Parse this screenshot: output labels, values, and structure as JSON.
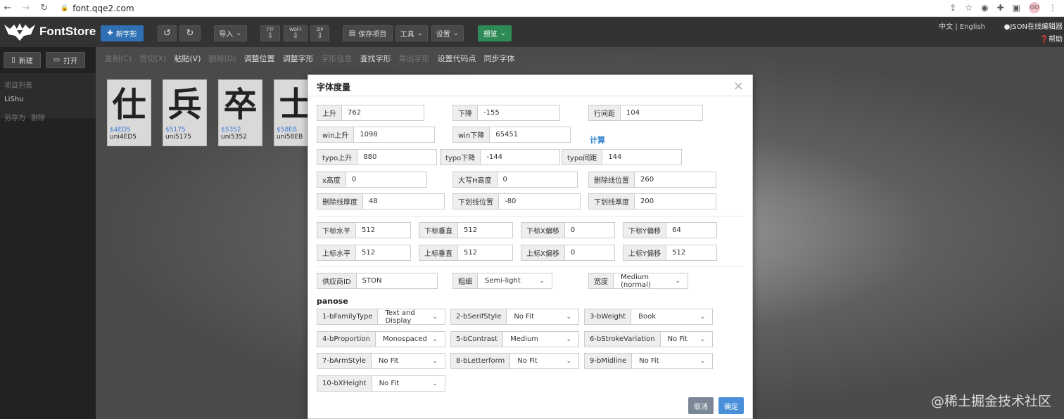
{
  "browser": {
    "url": "font.qqe2.com"
  },
  "app": {
    "name": "FontStore"
  },
  "toolbar": {
    "new_glyph": "新字形",
    "import": "导入",
    "export_ttf": "TTF",
    "export_woff": "WOFF",
    "export_zip": "ZIP",
    "save_project": "保存项目",
    "tools": "工具",
    "settings": "设置",
    "preview": "预览"
  },
  "header_links": {
    "lang_cn": "中文",
    "lang_sep": "|",
    "lang_en": "English",
    "json_editor": "JSON在线编辑器",
    "help": "帮助"
  },
  "sidebar": {
    "new": "新建",
    "open": "打开",
    "project_list": "项目列表",
    "project": "LiShu",
    "save_as": "另存为",
    "delete": "删除"
  },
  "edit_menu": [
    {
      "label": "复制(C)",
      "enabled": false
    },
    {
      "label": "剪切(X)",
      "enabled": false
    },
    {
      "label": "粘贴(V)",
      "enabled": true
    },
    {
      "label": "删除(D)",
      "enabled": false
    },
    {
      "label": "调整位置",
      "enabled": true
    },
    {
      "label": "调整字形",
      "enabled": true
    },
    {
      "label": "字形信息",
      "enabled": false
    },
    {
      "label": "查找字形",
      "enabled": true
    },
    {
      "label": "导出字形",
      "enabled": false
    },
    {
      "label": "设置代码点",
      "enabled": true
    },
    {
      "label": "同步字体",
      "enabled": true
    }
  ],
  "glyphs": [
    {
      "char": "仕",
      "code": "$4ED5",
      "name": "uni4ED5"
    },
    {
      "char": "兵",
      "code": "$5175",
      "name": "uni5175"
    },
    {
      "char": "卒",
      "code": "$5352",
      "name": "uni5352"
    },
    {
      "char": "士",
      "code": "$58EB",
      "name": "uni58EB"
    }
  ],
  "dialog": {
    "title": "字体度量",
    "close": "×",
    "calc": "计算",
    "fields": {
      "ascent": {
        "label": "上升",
        "value": "762"
      },
      "descent": {
        "label": "下降",
        "value": "-155"
      },
      "line_gap": {
        "label": "行间距",
        "value": "104"
      },
      "win_ascent": {
        "label": "win上升",
        "value": "1098"
      },
      "win_descent": {
        "label": "win下降",
        "value": "65451"
      },
      "typo_ascent": {
        "label": "typo上升",
        "value": "880"
      },
      "typo_descent": {
        "label": "typo下降",
        "value": "-144"
      },
      "typo_line_gap": {
        "label": "typo间距",
        "value": "144"
      },
      "x_height": {
        "label": "x高度",
        "value": "0"
      },
      "cap_height": {
        "label": "大写H高度",
        "value": "0"
      },
      "strikeout_pos": {
        "label": "删除线位置",
        "value": "260"
      },
      "strikeout_size": {
        "label": "删除线厚度",
        "value": "48"
      },
      "underline_pos": {
        "label": "下划线位置",
        "value": "-80"
      },
      "underline_thick": {
        "label": "下划线厚度",
        "value": "200"
      },
      "sub_x_size": {
        "label": "下标水平",
        "value": "512"
      },
      "sub_y_size": {
        "label": "下标垂直",
        "value": "512"
      },
      "sub_x_offset": {
        "label": "下标X偏移",
        "value": "0"
      },
      "sub_y_offset": {
        "label": "下标Y偏移",
        "value": "64"
      },
      "sup_x_size": {
        "label": "上标水平",
        "value": "512"
      },
      "sup_y_size": {
        "label": "上标垂直",
        "value": "512"
      },
      "sup_x_offset": {
        "label": "上标X偏移",
        "value": "0"
      },
      "sup_y_offset": {
        "label": "上标Y偏移",
        "value": "512"
      },
      "vendor_id": {
        "label": "供应商ID",
        "value": "STON"
      },
      "weight": {
        "label": "粗细",
        "value": "Semi-light"
      },
      "width": {
        "label": "宽度",
        "value": "Medium (normal)"
      }
    },
    "panose_title": "panose",
    "panose": {
      "p1": {
        "label": "1-bFamilyType",
        "value": "Text and Display"
      },
      "p2": {
        "label": "2-bSerifStyle",
        "value": "No Fit"
      },
      "p3": {
        "label": "3-bWeight",
        "value": "Book"
      },
      "p4": {
        "label": "4-bProportion",
        "value": "Monospaced"
      },
      "p5": {
        "label": "5-bContrast",
        "value": "Medium"
      },
      "p6": {
        "label": "6-bStrokeVariation",
        "value": "No Fit"
      },
      "p7": {
        "label": "7-bArmStyle",
        "value": "No Fit"
      },
      "p8": {
        "label": "8-bLetterform",
        "value": "No Fit"
      },
      "p9": {
        "label": "9-bMidline",
        "value": "No Fit"
      },
      "p10": {
        "label": "10-bXHeight",
        "value": "No Fit"
      }
    },
    "cancel": "取消",
    "ok": "确定"
  },
  "watermark": "@稀土掘金技术社区",
  "colors": {
    "primary": "#2f6fb4",
    "ok": "#4a90d9",
    "cancel": "#7a8796",
    "link": "#2a7fc9"
  }
}
